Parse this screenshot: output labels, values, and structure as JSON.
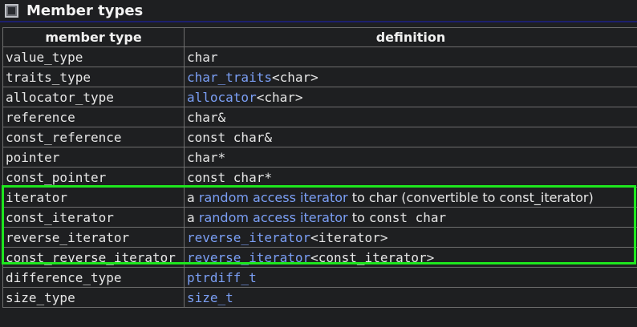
{
  "section": {
    "title": "Member types",
    "icon": "section-box-icon"
  },
  "table": {
    "headers": [
      "member type",
      "definition"
    ],
    "rows": [
      {
        "member": "value_type",
        "def": [
          {
            "t": "char",
            "style": "mono"
          }
        ]
      },
      {
        "member": "traits_type",
        "def": [
          {
            "t": "char_traits",
            "style": "mono-link"
          },
          {
            "t": "<char>",
            "style": "mono"
          }
        ]
      },
      {
        "member": "allocator_type",
        "def": [
          {
            "t": "allocator",
            "style": "mono-link"
          },
          {
            "t": "<char>",
            "style": "mono"
          }
        ]
      },
      {
        "member": "reference",
        "def": [
          {
            "t": "char&",
            "style": "mono"
          }
        ]
      },
      {
        "member": "const_reference",
        "def": [
          {
            "t": "const char&",
            "style": "mono"
          }
        ]
      },
      {
        "member": "pointer",
        "def": [
          {
            "t": "char*",
            "style": "mono"
          }
        ]
      },
      {
        "member": "const_pointer",
        "def": [
          {
            "t": "const char*",
            "style": "mono"
          }
        ]
      },
      {
        "member": "iterator",
        "def": [
          {
            "t": "a ",
            "style": "prose"
          },
          {
            "t": "random access iterator",
            "style": "prose-link"
          },
          {
            "t": " to ",
            "style": "prose"
          },
          {
            "t": "char",
            "style": "prose"
          },
          {
            "t": " (convertible to ",
            "style": "prose"
          },
          {
            "t": "const_iterator",
            "style": "prose"
          },
          {
            "t": ")",
            "style": "prose"
          }
        ]
      },
      {
        "member": "const_iterator",
        "def": [
          {
            "t": "a ",
            "style": "prose"
          },
          {
            "t": "random access iterator",
            "style": "prose-link"
          },
          {
            "t": " to ",
            "style": "prose"
          },
          {
            "t": "const char",
            "style": "mono"
          }
        ]
      },
      {
        "member": "reverse_iterator",
        "def": [
          {
            "t": "reverse_iterator",
            "style": "mono-link"
          },
          {
            "t": "<iterator>",
            "style": "mono"
          }
        ]
      },
      {
        "member": "const_reverse_iterator",
        "def": [
          {
            "t": "reverse_iterator",
            "style": "mono-link"
          },
          {
            "t": "<const_iterator>",
            "style": "mono"
          }
        ]
      },
      {
        "member": "difference_type",
        "def": [
          {
            "t": "ptrdiff_t",
            "style": "mono-link"
          }
        ]
      },
      {
        "member": "size_type",
        "def": [
          {
            "t": "size_t",
            "style": "mono-link"
          }
        ]
      }
    ]
  },
  "highlight": {
    "color": "#1ee61e",
    "rows": [
      "iterator",
      "const_iterator",
      "reverse_iterator",
      "const_reverse_iterator"
    ]
  },
  "colors": {
    "background": "#1e1f21",
    "text": "#e6e6e6",
    "link": "#7b9ff5",
    "grid": "#6e6e6e",
    "header_rule": "#1c1f6e"
  }
}
